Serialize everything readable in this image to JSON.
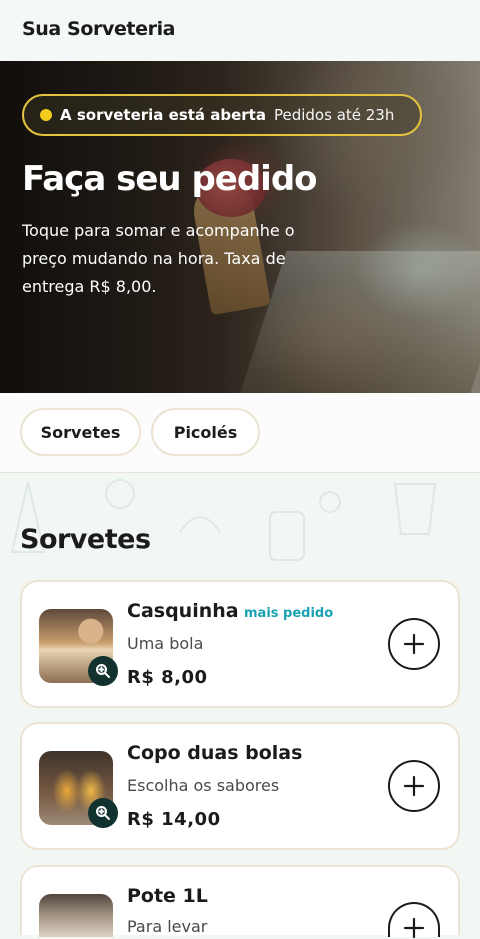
{
  "header": {
    "brand": "Sua Sorveteria"
  },
  "hero": {
    "status_open": "A sorveteria está aberta",
    "status_hours": "Pedidos até 23h",
    "title": "Faça seu pedido",
    "subtitle": "Toque para somar e acompanhe o preço mudando na hora. Taxa de entrega R$ 8,00."
  },
  "tabs": [
    {
      "label": "Sorvetes"
    },
    {
      "label": "Picolés"
    }
  ],
  "section": {
    "title": "Sorvetes"
  },
  "items": [
    {
      "name": "Casquinha",
      "badge": "mais pedido",
      "desc": "Uma bola",
      "price": "R$ 8,00"
    },
    {
      "name": "Copo duas bolas",
      "badge": "",
      "desc": "Escolha os sabores",
      "price": "R$ 14,00"
    },
    {
      "name": "Pote 1L",
      "badge": "",
      "desc": "Para levar",
      "price": ""
    }
  ],
  "colors": {
    "accent_yellow": "#e5c33e",
    "badge_teal": "#1aa3b2",
    "zoom_dark": "#11322e",
    "background": "#f2f7f4"
  },
  "icons": {
    "zoom": "zoom-in-icon",
    "add": "plus-icon"
  }
}
